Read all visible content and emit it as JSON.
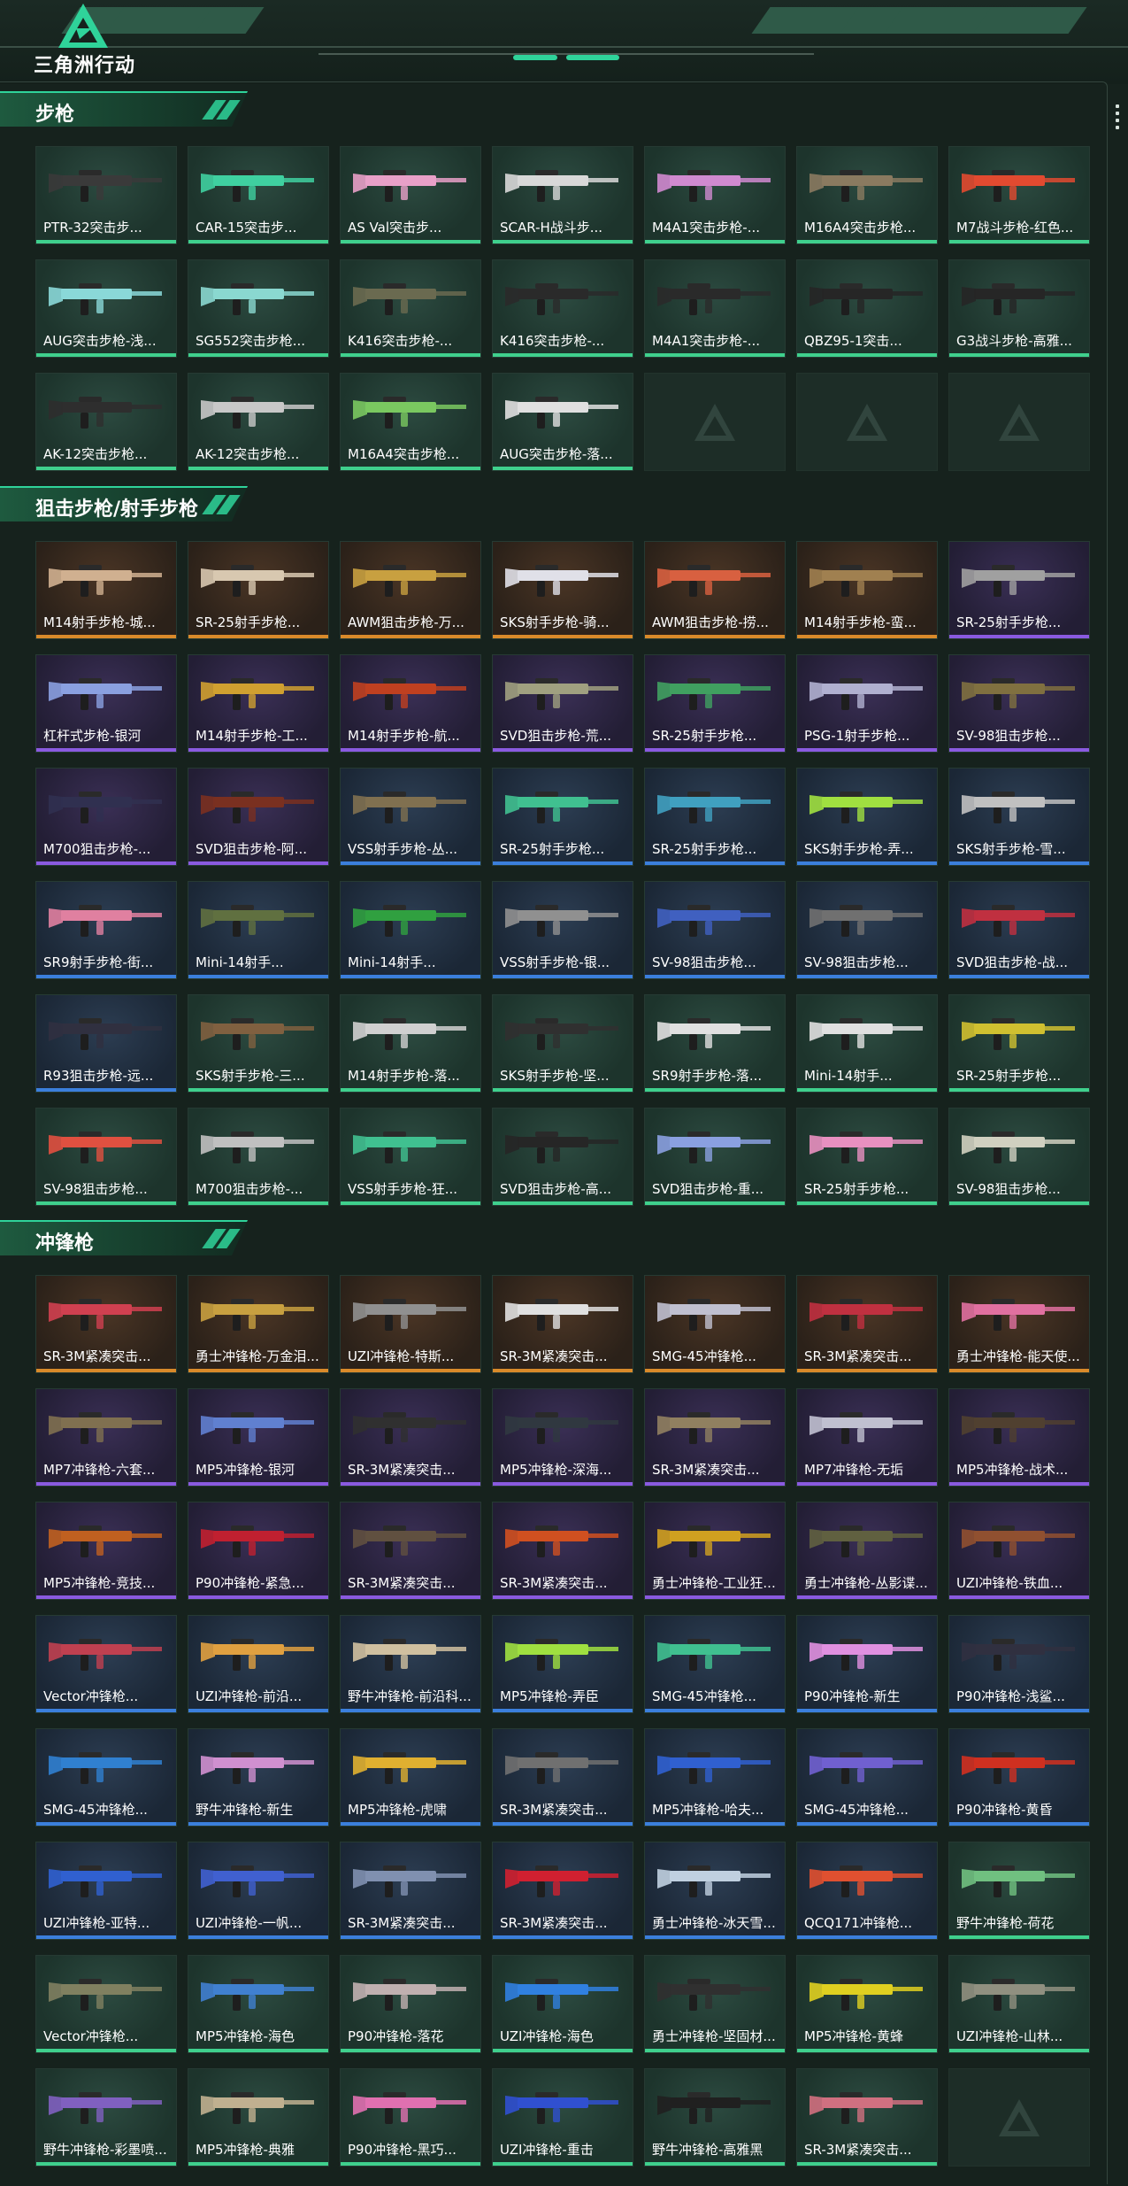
{
  "header": {
    "app_title": "三角洲行动",
    "accent": "#2fd39a"
  },
  "sections": [
    {
      "title": "步枪",
      "items": [
        {
          "label": "PTR-32突击步...",
          "rarity": "green",
          "color": "#3a3a3a"
        },
        {
          "label": "CAR-15突击步...",
          "rarity": "green",
          "color": "#3fd0a0"
        },
        {
          "label": "AS Val突击步...",
          "rarity": "green",
          "color": "#e8a0c8"
        },
        {
          "label": "SCAR-H战斗步...",
          "rarity": "green",
          "color": "#d8d8d8"
        },
        {
          "label": "M4A1突击步枪-...",
          "rarity": "green",
          "color": "#d08ad0"
        },
        {
          "label": "M16A4突击步枪...",
          "rarity": "green",
          "color": "#8a7a60"
        },
        {
          "label": "M7战斗步枪-红色...",
          "rarity": "green",
          "color": "#e24a30"
        },
        {
          "label": "AUG突击步枪-浅...",
          "rarity": "green",
          "color": "#8ad8d8"
        },
        {
          "label": "SG552突击步枪...",
          "rarity": "green",
          "color": "#8ad8d0"
        },
        {
          "label": "K416突击步枪-...",
          "rarity": "green",
          "color": "#6a6a50"
        },
        {
          "label": "K416突击步枪-...",
          "rarity": "green",
          "color": "#2a2a2a"
        },
        {
          "label": "M4A1突击步枪-...",
          "rarity": "green",
          "color": "#2a2a2a"
        },
        {
          "label": "QBZ95-1突击...",
          "rarity": "green",
          "color": "#262626"
        },
        {
          "label": "G3战斗步枪-高雅...",
          "rarity": "green",
          "color": "#262626"
        },
        {
          "label": "AK-12突击步枪...",
          "rarity": "green",
          "color": "#2e2e2e"
        },
        {
          "label": "AK-12突击步枪...",
          "rarity": "green",
          "color": "#c8c8c8"
        },
        {
          "label": "M16A4突击步枪...",
          "rarity": "green",
          "color": "#7ac860"
        },
        {
          "label": "AUG突击步枪-落...",
          "rarity": "green",
          "color": "#e0e0e0"
        },
        {
          "label": "",
          "rarity": "empty",
          "color": ""
        },
        {
          "label": "",
          "rarity": "empty",
          "color": ""
        },
        {
          "label": "",
          "rarity": "empty",
          "color": ""
        }
      ]
    },
    {
      "title": "狙击步枪/射手步枪",
      "items": [
        {
          "label": "M14射手步枪-城...",
          "rarity": "gold",
          "color": "#d0b090"
        },
        {
          "label": "SR-25射手步枪...",
          "rarity": "gold",
          "color": "#d8c8b0"
        },
        {
          "label": "AWM狙击步枪-万...",
          "rarity": "gold",
          "color": "#c8a040"
        },
        {
          "label": "SKS射手步枪-骑...",
          "rarity": "gold",
          "color": "#e0e0e8"
        },
        {
          "label": "AWM狙击步枪-捞...",
          "rarity": "gold",
          "color": "#d86040"
        },
        {
          "label": "M14射手步枪-蛮...",
          "rarity": "gold",
          "color": "#a08050"
        },
        {
          "label": "SR-25射手步枪...",
          "rarity": "purple",
          "color": "#a0a0a0"
        },
        {
          "label": "杠杆式步枪-银河",
          "rarity": "purple",
          "color": "#8aa0e0"
        },
        {
          "label": "M14射手步枪-工...",
          "rarity": "purple",
          "color": "#d0a030"
        },
        {
          "label": "M14射手步枪-航...",
          "rarity": "purple",
          "color": "#c04020"
        },
        {
          "label": "SVD狙击步枪-荒...",
          "rarity": "purple",
          "color": "#a0a080"
        },
        {
          "label": "SR-25射手步枪...",
          "rarity": "purple",
          "color": "#40a060"
        },
        {
          "label": "PSG-1射手步枪...",
          "rarity": "purple",
          "color": "#b0b0d0"
        },
        {
          "label": "SV-98狙击步枪...",
          "rarity": "purple",
          "color": "#807040"
        },
        {
          "label": "M700狙击步枪-...",
          "rarity": "purple",
          "color": "#303050"
        },
        {
          "label": "SVD狙击步枪-阿...",
          "rarity": "purple",
          "color": "#7a3020"
        },
        {
          "label": "VSS射手步枪-丛...",
          "rarity": "blue",
          "color": "#807050"
        },
        {
          "label": "SR-25射手步枪...",
          "rarity": "blue",
          "color": "#40c090"
        },
        {
          "label": "SR-25射手步枪...",
          "rarity": "blue",
          "color": "#40a0c0"
        },
        {
          "label": "SKS射手步枪-弄...",
          "rarity": "blue",
          "color": "#a0e040"
        },
        {
          "label": "SKS射手步枪-雪...",
          "rarity": "blue",
          "color": "#c0c0c0"
        },
        {
          "label": "SR9射手步枪-街...",
          "rarity": "blue",
          "color": "#e080a0"
        },
        {
          "label": "Mini-14射手...",
          "rarity": "blue",
          "color": "#607040"
        },
        {
          "label": "Mini-14射手...",
          "rarity": "blue",
          "color": "#30a040"
        },
        {
          "label": "VSS射手步枪-银...",
          "rarity": "blue",
          "color": "#909090"
        },
        {
          "label": "SV-98狙击步枪...",
          "rarity": "blue",
          "color": "#4060c0"
        },
        {
          "label": "SV-98狙击步枪...",
          "rarity": "blue",
          "color": "#707070"
        },
        {
          "label": "SVD狙击步枪-战...",
          "rarity": "blue",
          "color": "#c03040"
        },
        {
          "label": "R93狙击步枪-远...",
          "rarity": "blue",
          "color": "#303040"
        },
        {
          "label": "SKS射手步枪-三...",
          "rarity": "green",
          "color": "#806040"
        },
        {
          "label": "M14射手步枪-落...",
          "rarity": "green",
          "color": "#d0d0d0"
        },
        {
          "label": "SKS射手步枪-坚...",
          "rarity": "green",
          "color": "#303030"
        },
        {
          "label": "SR9射手步枪-落...",
          "rarity": "green",
          "color": "#e0e0e0"
        },
        {
          "label": "Mini-14射手...",
          "rarity": "green",
          "color": "#e0e0e0"
        },
        {
          "label": "SR-25射手步枪...",
          "rarity": "green",
          "color": "#d0c030"
        },
        {
          "label": "SV-98狙击步枪...",
          "rarity": "green",
          "color": "#e05040"
        },
        {
          "label": "M700狙击步枪-...",
          "rarity": "green",
          "color": "#c0c0c0"
        },
        {
          "label": "VSS射手步枪-狂...",
          "rarity": "green",
          "color": "#40c090"
        },
        {
          "label": "SVD狙击步枪-高...",
          "rarity": "green",
          "color": "#262626"
        },
        {
          "label": "SVD狙击步枪-重...",
          "rarity": "green",
          "color": "#8aa0e0"
        },
        {
          "label": "SR-25射手步枪...",
          "rarity": "green",
          "color": "#e890c0"
        },
        {
          "label": "SV-98狙击步枪...",
          "rarity": "green",
          "color": "#d0d0c0"
        }
      ]
    },
    {
      "title": "冲锋枪",
      "items": [
        {
          "label": "SR-3M紧凑突击...",
          "rarity": "gold",
          "color": "#d04050"
        },
        {
          "label": "勇士冲锋枪-万金泪...",
          "rarity": "gold",
          "color": "#c8a040"
        },
        {
          "label": "UZI冲锋枪-特斯...",
          "rarity": "gold",
          "color": "#909090"
        },
        {
          "label": "SR-3M紧凑突击...",
          "rarity": "gold",
          "color": "#e0e0e0"
        },
        {
          "label": "SMG-45冲锋枪...",
          "rarity": "gold",
          "color": "#c0c0d0"
        },
        {
          "label": "SR-3M紧凑突击...",
          "rarity": "gold",
          "color": "#c03040"
        },
        {
          "label": "勇士冲锋枪-能天使...",
          "rarity": "gold",
          "color": "#e070a0"
        },
        {
          "label": "MP7冲锋枪-六套...",
          "rarity": "purple",
          "color": "#807050"
        },
        {
          "label": "MP5冲锋枪-银河",
          "rarity": "purple",
          "color": "#6080d0"
        },
        {
          "label": "SR-3M紧凑突击...",
          "rarity": "purple",
          "color": "#303030"
        },
        {
          "label": "MP5冲锋枪-深海...",
          "rarity": "purple",
          "color": "#303840"
        },
        {
          "label": "SR-3M紧凑突击...",
          "rarity": "purple",
          "color": "#908060"
        },
        {
          "label": "MP7冲锋枪-无垢",
          "rarity": "purple",
          "color": "#c0c0d0"
        },
        {
          "label": "MP5冲锋枪-战术...",
          "rarity": "purple",
          "color": "#504030"
        },
        {
          "label": "MP5冲锋枪-竞技...",
          "rarity": "purple",
          "color": "#c06020"
        },
        {
          "label": "P90冲锋枪-紧急...",
          "rarity": "purple",
          "color": "#c02030"
        },
        {
          "label": "SR-3M紧凑突击...",
          "rarity": "purple",
          "color": "#605040"
        },
        {
          "label": "SR-3M紧凑突击...",
          "rarity": "purple",
          "color": "#d05020"
        },
        {
          "label": "勇士冲锋枪-工业狂...",
          "rarity": "purple",
          "color": "#d0a020"
        },
        {
          "label": "勇士冲锋枪-丛影谍...",
          "rarity": "purple",
          "color": "#606040"
        },
        {
          "label": "UZI冲锋枪-铁血...",
          "rarity": "purple",
          "color": "#905030"
        },
        {
          "label": "Vector冲锋枪...",
          "rarity": "blue",
          "color": "#c04050"
        },
        {
          "label": "UZI冲锋枪-前沿...",
          "rarity": "blue",
          "color": "#e0a040"
        },
        {
          "label": "野牛冲锋枪-前沿科...",
          "rarity": "blue",
          "color": "#d0c0a0"
        },
        {
          "label": "MP5冲锋枪-弄臣",
          "rarity": "blue",
          "color": "#a0e040"
        },
        {
          "label": "SMG-45冲锋枪...",
          "rarity": "blue",
          "color": "#40c090"
        },
        {
          "label": "P90冲锋枪-新生",
          "rarity": "blue",
          "color": "#e090e0"
        },
        {
          "label": "P90冲锋枪-浅鲨...",
          "rarity": "blue",
          "color": "#303040"
        },
        {
          "label": "SMG-45冲锋枪...",
          "rarity": "blue",
          "color": "#3080d0"
        },
        {
          "label": "野牛冲锋枪-新生",
          "rarity": "blue",
          "color": "#d090d0"
        },
        {
          "label": "MP5冲锋枪-虎啸",
          "rarity": "blue",
          "color": "#e0b030"
        },
        {
          "label": "SR-3M紧凑突击...",
          "rarity": "blue",
          "color": "#707070"
        },
        {
          "label": "MP5冲锋枪-哈夫...",
          "rarity": "blue",
          "color": "#3060d0"
        },
        {
          "label": "SMG-45冲锋枪...",
          "rarity": "blue",
          "color": "#7060d0"
        },
        {
          "label": "P90冲锋枪-黄昏",
          "rarity": "blue",
          "color": "#d03020"
        },
        {
          "label": "UZI冲锋枪-亚特...",
          "rarity": "blue",
          "color": "#3060d0"
        },
        {
          "label": "UZI冲锋枪-一帆...",
          "rarity": "blue",
          "color": "#4060d0"
        },
        {
          "label": "SR-3M紧凑突击...",
          "rarity": "blue",
          "color": "#8090b0"
        },
        {
          "label": "SR-3M紧凑突击...",
          "rarity": "blue",
          "color": "#d02030"
        },
        {
          "label": "勇士冲锋枪-冰天雪...",
          "rarity": "blue",
          "color": "#c0d0e0"
        },
        {
          "label": "QCQ171冲锋枪...",
          "rarity": "blue",
          "color": "#e05030"
        },
        {
          "label": "野牛冲锋枪-荷花",
          "rarity": "green",
          "color": "#70c080"
        },
        {
          "label": "Vector冲锋枪...",
          "rarity": "green",
          "color": "#808060"
        },
        {
          "label": "MP5冲锋枪-海色",
          "rarity": "green",
          "color": "#4080d0"
        },
        {
          "label": "P90冲锋枪-落花",
          "rarity": "green",
          "color": "#c0b0b0"
        },
        {
          "label": "UZI冲锋枪-海色",
          "rarity": "green",
          "color": "#3080e0"
        },
        {
          "label": "勇士冲锋枪-坚固材...",
          "rarity": "green",
          "color": "#303030"
        },
        {
          "label": "MP5冲锋枪-黄蜂",
          "rarity": "green",
          "color": "#e0d020"
        },
        {
          "label": "UZI冲锋枪-山林...",
          "rarity": "green",
          "color": "#909080"
        },
        {
          "label": "野牛冲锋枪-彩墨喷...",
          "rarity": "green",
          "color": "#8060c0"
        },
        {
          "label": "MP5冲锋枪-典雅",
          "rarity": "green",
          "color": "#c0b090"
        },
        {
          "label": "P90冲锋枪-黑巧...",
          "rarity": "green",
          "color": "#e070b0"
        },
        {
          "label": "UZI冲锋枪-重击",
          "rarity": "green",
          "color": "#3050d0"
        },
        {
          "label": "野牛冲锋枪-高雅黑",
          "rarity": "green",
          "color": "#202020"
        },
        {
          "label": "SR-3M紧凑突击...",
          "rarity": "green",
          "color": "#d07080"
        },
        {
          "label": "",
          "rarity": "empty",
          "color": ""
        }
      ]
    }
  ]
}
